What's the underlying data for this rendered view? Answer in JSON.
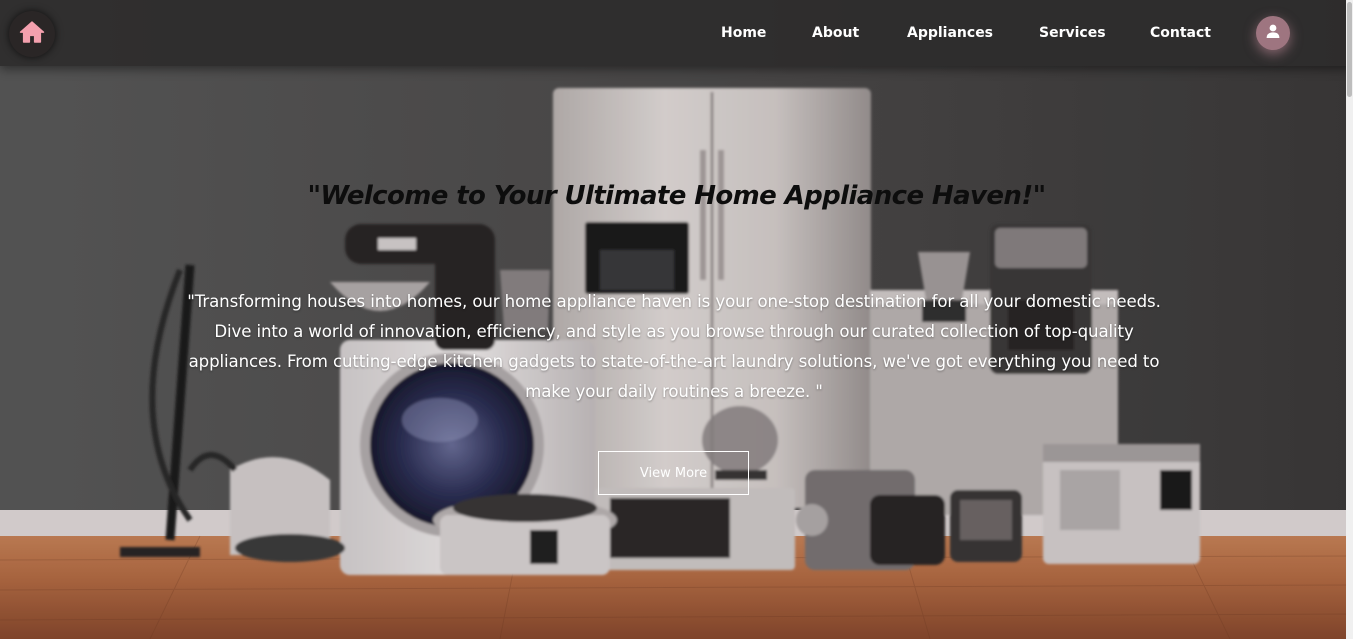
{
  "nav": {
    "home_icon": "home-icon",
    "links": [
      "Home",
      "About",
      "Appliances",
      "Services",
      "Contact"
    ],
    "user_icon": "user-icon"
  },
  "hero": {
    "title": "\"Welcome to Your Ultimate Home Appliance Haven!\"",
    "description": "\"Transforming houses into homes, our home appliance haven is your one-stop destination for all your domestic needs. Dive into a world of innovation, efficiency, and style as you browse through our curated collection of top-quality appliances. From cutting-edge kitchen gadgets to state-of-the-art laundry solutions, we've got everything you need to make your daily routines a breeze. \"",
    "cta_label": "View More"
  },
  "colors": {
    "navbar": "#2d2c2c",
    "home_icon": "#f4a0ae",
    "user_button": "#9e7580",
    "wall": "#4b4b4b",
    "floor": "#a0583a"
  }
}
